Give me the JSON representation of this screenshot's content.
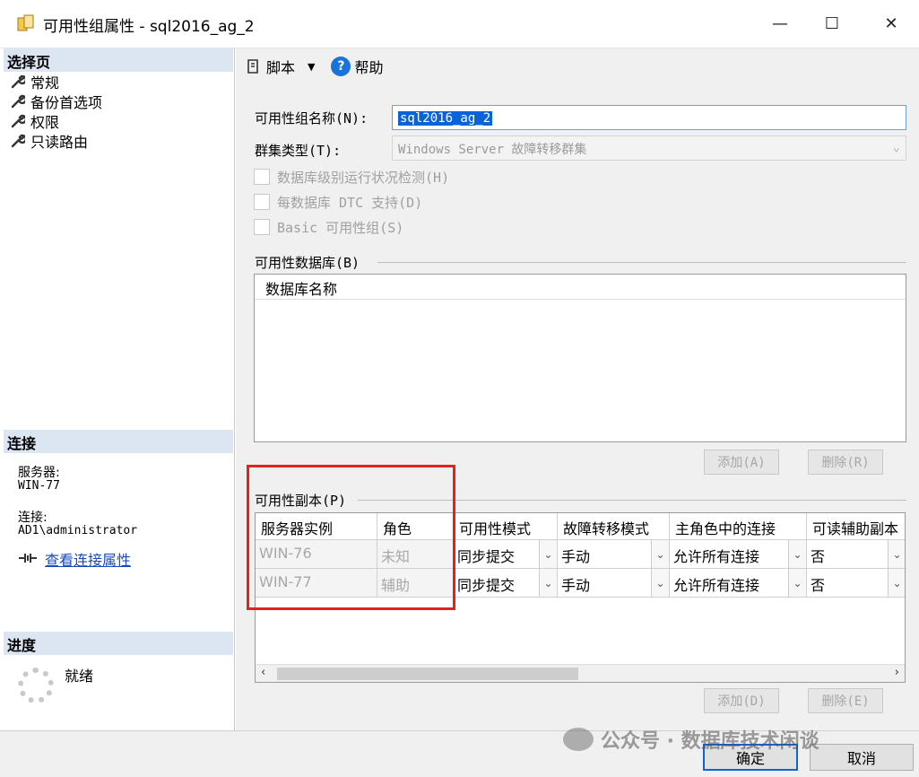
{
  "window": {
    "title": "可用性组属性 - sql2016_ag_2",
    "minimize": "—",
    "maximize": "☐",
    "close": "✕"
  },
  "left": {
    "select_page_header": "选择页",
    "pages": [
      "常规",
      "备份首选项",
      "权限",
      "只读路由"
    ],
    "connection_header": "连接",
    "server_label": "服务器:",
    "server_value": "WIN-77",
    "conn_label": "连接:",
    "conn_value": "AD1\\administrator",
    "view_conn_link": "查看连接属性",
    "progress_header": "进度",
    "progress_status": "就绪"
  },
  "toolbar": {
    "script_label": "脚本",
    "script_arrow": "▼",
    "help_label": "帮助"
  },
  "form": {
    "ag_name_label": "可用性组名称(N):",
    "ag_name_value": "sql2016_ag_2",
    "cluster_type_label": "群集类型(T):",
    "cluster_type_value": "Windows Server 故障转移群集",
    "db_health_label": "数据库级别运行状况检测(H)",
    "dtc_label": "每数据库 DTC 支持(D)",
    "basic_label": "Basic 可用性组(S)"
  },
  "databases": {
    "group_label": "可用性数据库(B)",
    "column_header": "数据库名称",
    "add_button": "添加(A)",
    "remove_button": "删除(R)"
  },
  "replicas": {
    "group_label": "可用性副本(P)",
    "columns": [
      "服务器实例",
      "角色",
      "可用性模式",
      "故障转移模式",
      "主角色中的连接",
      "可读辅助副本"
    ],
    "rows": [
      {
        "server": "WIN-76",
        "role": "未知",
        "avail_mode": "同步提交",
        "failover": "手动",
        "primary_conn": "允许所有连接",
        "readable": "否"
      },
      {
        "server": "WIN-77",
        "role": "辅助",
        "avail_mode": "同步提交",
        "failover": "手动",
        "primary_conn": "允许所有连接",
        "readable": "否"
      }
    ],
    "add_button": "添加(D)",
    "remove_button": "删除(E)"
  },
  "footer": {
    "ok_button": "确定",
    "cancel_button": "取消",
    "watermark": "公众号 · 数据库技术闲谈"
  }
}
